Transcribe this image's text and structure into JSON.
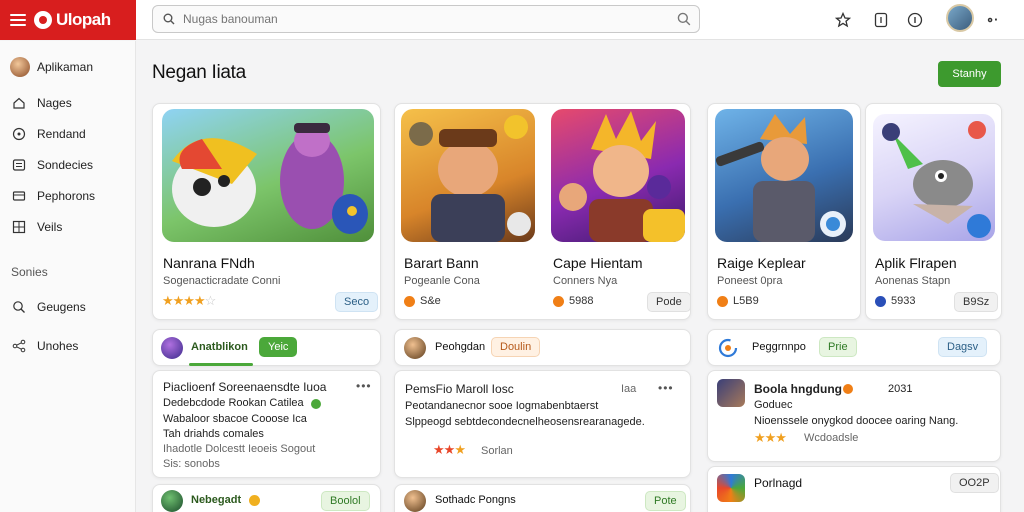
{
  "brand": {
    "name": "Ulopah",
    "color": "#d81e1e"
  },
  "search": {
    "placeholder": "Nugas banouman"
  },
  "header_icons": [
    "bookmark-star-icon",
    "clipboard-icon",
    "info-icon"
  ],
  "sidebar": {
    "items": [
      {
        "label": "Aplikaman",
        "icon": "user-avatar"
      },
      {
        "label": "Nages",
        "icon": "home-icon"
      },
      {
        "label": "Rendand",
        "icon": "compass-icon"
      },
      {
        "label": "Sondecies",
        "icon": "list-icon"
      },
      {
        "label": "Pephorons",
        "icon": "card-icon"
      },
      {
        "label": "Veils",
        "icon": "grid-icon"
      }
    ],
    "section_label": "Sonies",
    "section_items": [
      {
        "label": "Geugens",
        "icon": "search-icon"
      },
      {
        "label": "Unohes",
        "icon": "share-icon"
      }
    ]
  },
  "main": {
    "title": "Negan Iiata",
    "primary_button": "Stanhy",
    "featured": [
      {
        "title": "Nanrana FNdh",
        "subtitle": "Sogenacticradate Conni",
        "rating": 4,
        "badge": "Seco"
      },
      {
        "title": "Barart Bann",
        "subtitle": "Pogeanle Cona",
        "price": "S&e",
        "accent": "#f07f16"
      },
      {
        "title": "Cape Hientam",
        "subtitle": "Conners Nya",
        "price": "5988",
        "badge": "Pode",
        "accent": "#f07f16"
      },
      {
        "title": "Raige Keplear",
        "subtitle": "Poneest 0pra",
        "price": "L5B9",
        "accent": "#f07f16"
      },
      {
        "title": "Aplik Flrapen",
        "subtitle": "Aonenas Stapn",
        "price": "5933",
        "badge": "B9Sz",
        "accent": "#2a4fb8"
      }
    ],
    "rows": [
      {
        "label": "Anatblikon",
        "tag": "Yeic",
        "tag_color": "#4ba83a"
      },
      {
        "label": "Peohgdan",
        "tag": "Doulin",
        "tag_color": "#b6591a"
      },
      {
        "label": "Peggrnnpo",
        "tag": "Prie",
        "badge": "Dagsv"
      }
    ],
    "posts": [
      {
        "lines": [
          "Piaclioenf Soreenaensdte Iuoa",
          "Dedebcdode Rookan Catilea",
          "Wabaloor sbacoe Cooose Ica",
          "Tah driahds comales",
          "Ihadotle Dolcestt Ieoeis Sogout",
          "Sis: sonobs"
        ],
        "accent": "#4ba83a"
      },
      {
        "lines": [
          "PemsFio Maroll Iosc",
          "Peotandanecnor sooe Iogmabenbtaerst",
          "Slppeogd sebtdecondecnelheosensrearanagede."
        ],
        "rating": 2,
        "meta": "Sorlan",
        "stat": "Iaa"
      },
      {
        "lines": [
          "Boola hngdung",
          "Goduec",
          "Nioenssele onygkod doocee oaring Nang.",
          "Wcdoadsle"
        ],
        "rating": 3,
        "num": "2031"
      }
    ],
    "bottom": [
      {
        "label": "Nebegadt",
        "tag": "Boolol"
      },
      {
        "label": "Sothadc Pongns",
        "tag": "Pote"
      },
      {
        "label": "Porlnagd",
        "tag": "OO2P"
      }
    ]
  }
}
